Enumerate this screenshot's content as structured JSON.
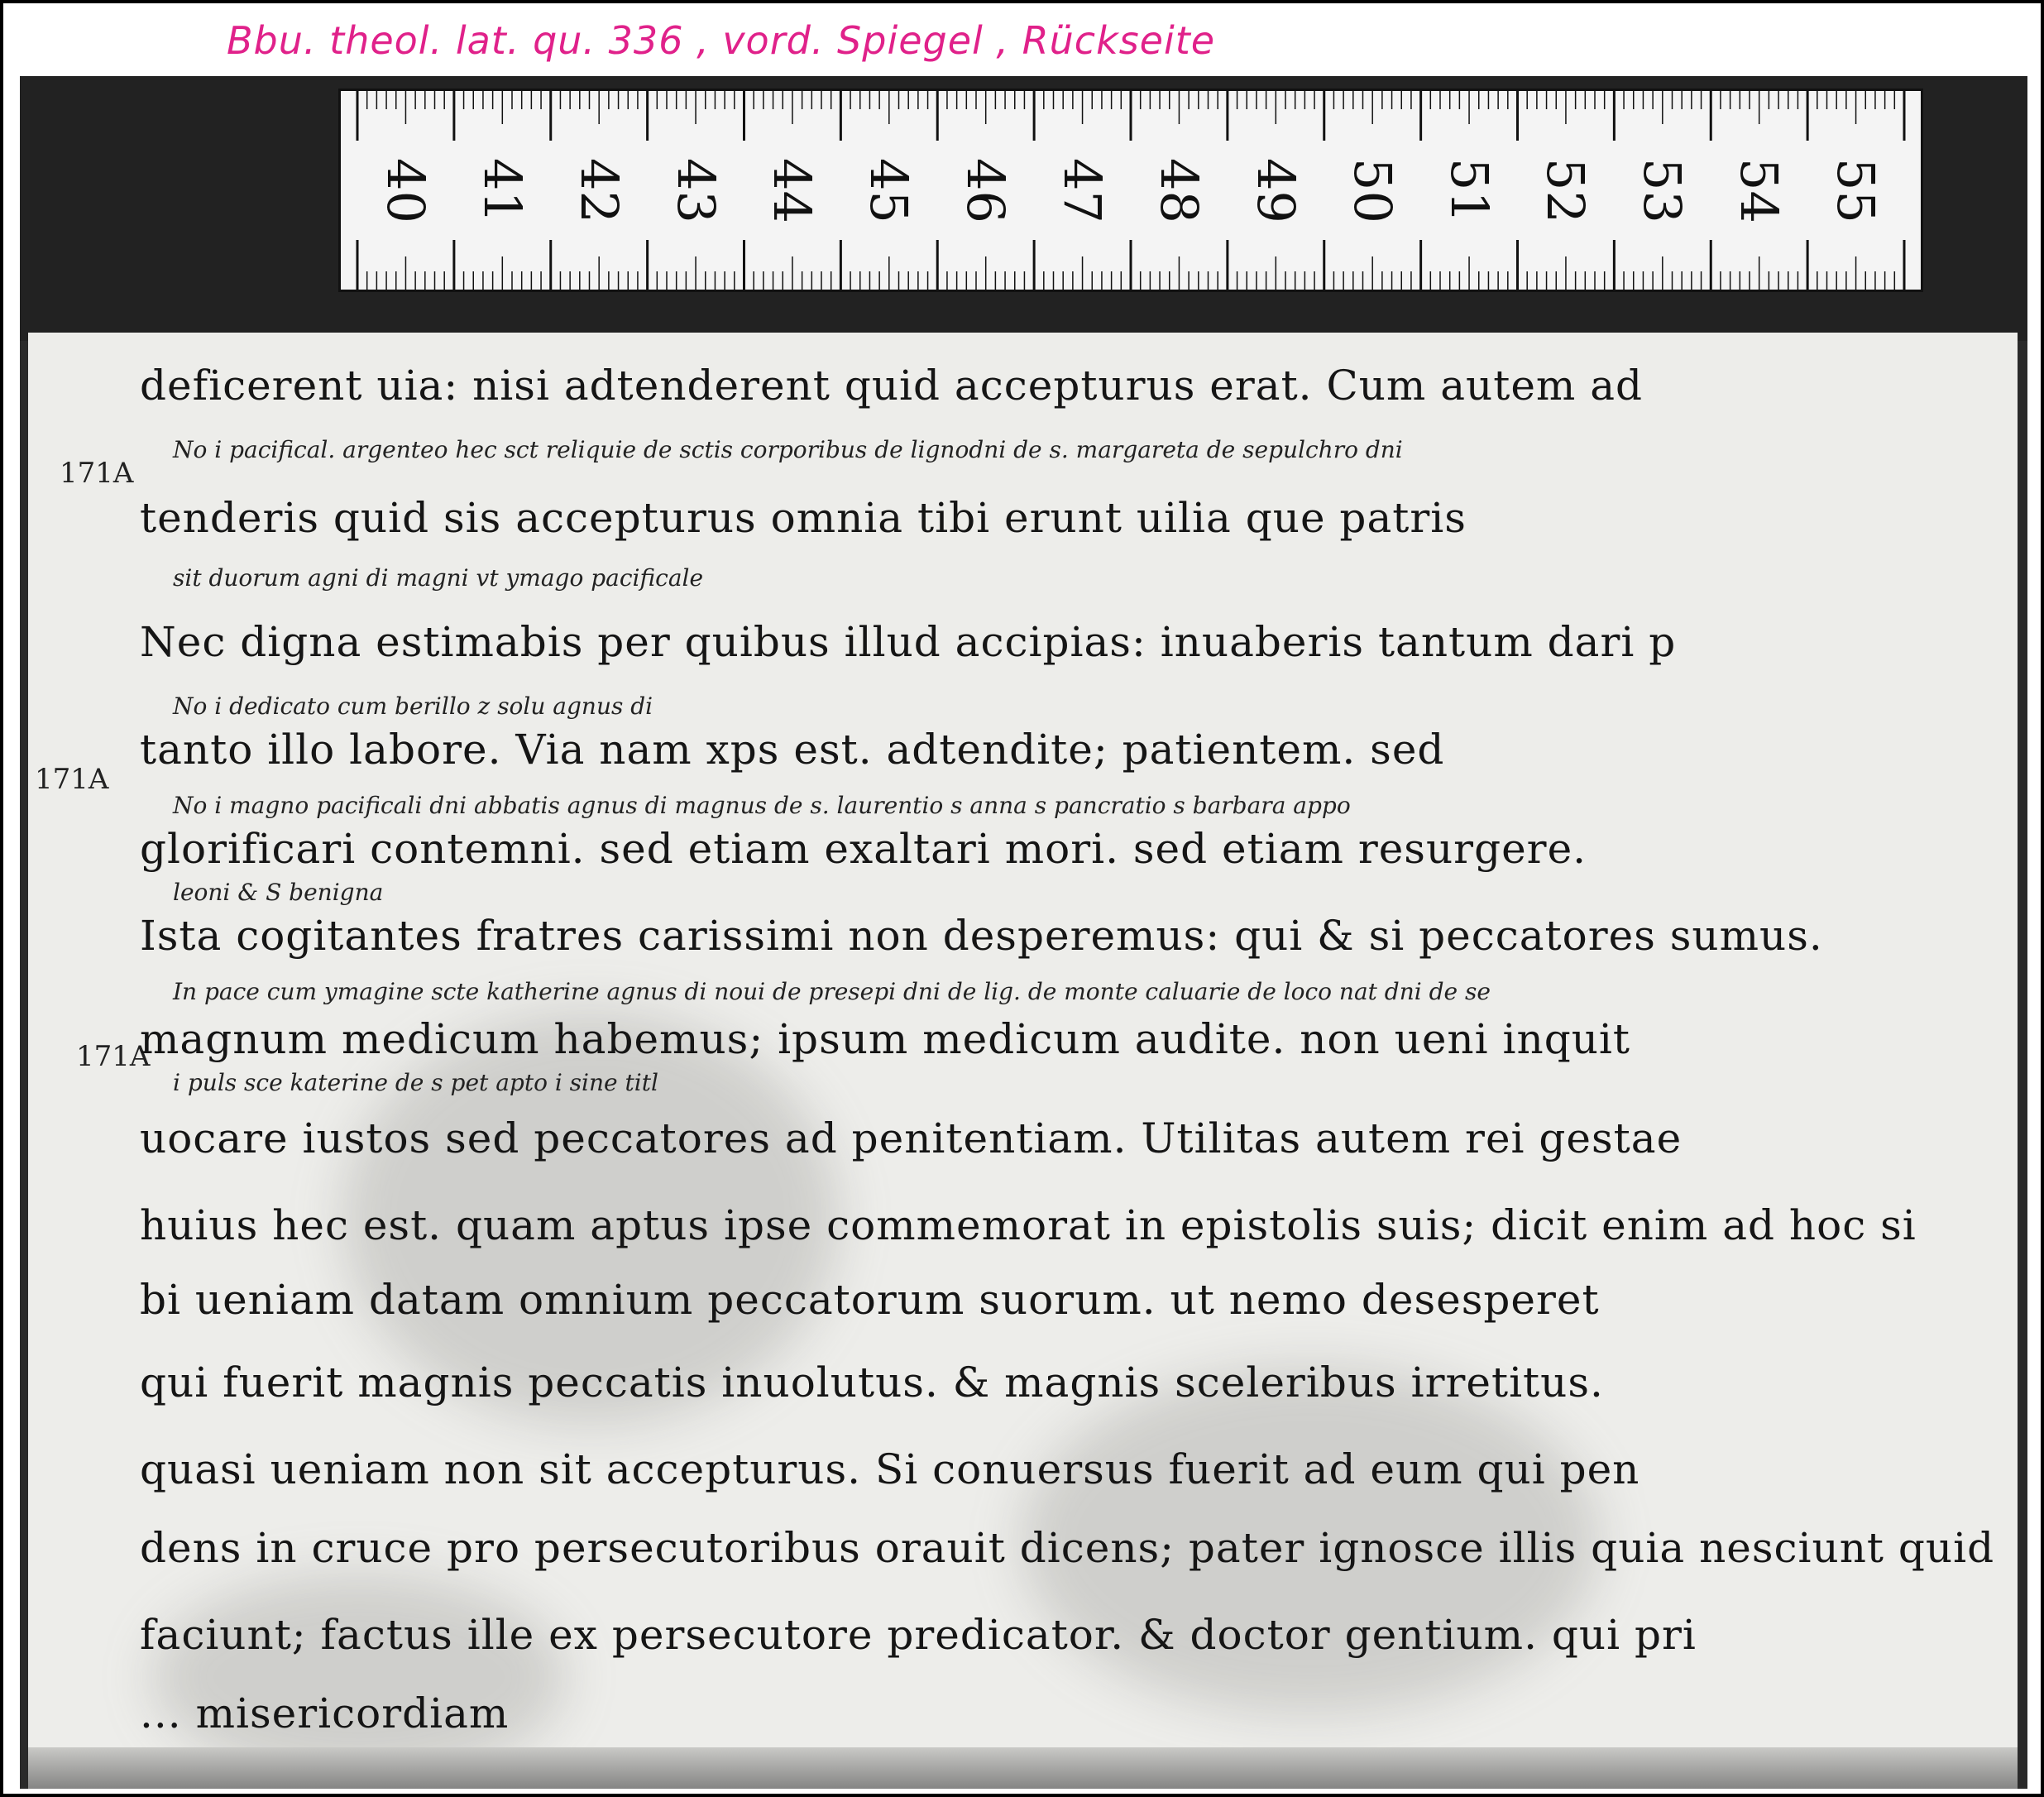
{
  "header_label": "Bbu. theol. lat. qu. 336 , vord. Spiegel , Rückseite",
  "ruler": {
    "numbers": [
      "40",
      "41",
      "42",
      "43",
      "44",
      "45",
      "46",
      "47",
      "48",
      "49",
      "50",
      "51",
      "52",
      "53",
      "54",
      "55"
    ]
  },
  "margin_numbers": [
    "171A",
    "171A",
    "171A"
  ],
  "manuscript_lines": [
    {
      "kind": "main",
      "text": "deficerent uia: nisi adtenderent quid accepturus erat. Cum autem ad"
    },
    {
      "kind": "gloss",
      "text": "No i pacifical. argenteo hec sct reliquie de sctis corporibus de lignodni de s. margareta de sepulchro dni"
    },
    {
      "kind": "main",
      "text": "tenderis quid sis accepturus omnia tibi erunt uilia que patris"
    },
    {
      "kind": "gloss",
      "text": "sit duorum agni di magni vt ymago pacificale"
    },
    {
      "kind": "main",
      "text": "Nec digna estimabis per quibus illud accipias: inuaberis tantum dari p"
    },
    {
      "kind": "gloss",
      "text": "No i dedicato cum berillo z solu agnus di"
    },
    {
      "kind": "main",
      "text": "tanto illo labore. Via nam xps est. adtendite; patientem. sed"
    },
    {
      "kind": "gloss",
      "text": "No i magno pacificali dni abbatis agnus di magnus de s. laurentio s anna s pancratio s barbara appo"
    },
    {
      "kind": "main",
      "text": "glorificari contemni. sed etiam exaltari mori. sed etiam resurgere."
    },
    {
      "kind": "gloss",
      "text": "leoni & S benigna"
    },
    {
      "kind": "main",
      "text": "Ista cogitantes fratres carissimi non desperemus: qui & si peccatores sumus."
    },
    {
      "kind": "gloss",
      "text": "In pace cum ymagine scte katherine agnus di noui de presepi dni de lig. de monte caluarie de loco nat dni de se"
    },
    {
      "kind": "main",
      "text": "magnum medicum habemus; ipsum medicum audite. non ueni inquit"
    },
    {
      "kind": "gloss",
      "text": "i puls sce katerine de s pet apto i sine titl"
    },
    {
      "kind": "main",
      "text": "uocare iustos sed peccatores ad penitentiam. Utilitas autem rei gestae"
    },
    {
      "kind": "main",
      "text": "huius hec est. quam aptus ipse commemorat in epistolis suis; dicit enim ad hoc si"
    },
    {
      "kind": "main",
      "text": "bi ueniam datam omnium peccatorum suorum. ut nemo desesperet"
    },
    {
      "kind": "main",
      "text": "qui fuerit magnis peccatis inuolutus. & magnis sceleribus irretitus."
    },
    {
      "kind": "main",
      "text": "quasi ueniam non sit accepturus. Si conuersus fuerit ad eum qui pen"
    },
    {
      "kind": "main",
      "text": "dens in cruce pro persecutoribus orauit dicens; pater ignosce illis quia nesciunt quid"
    },
    {
      "kind": "main",
      "text": "faciunt; factus ille ex persecutore predicator. & doctor gentium. qui pri"
    },
    {
      "kind": "main",
      "text": "... misericordiam"
    }
  ]
}
